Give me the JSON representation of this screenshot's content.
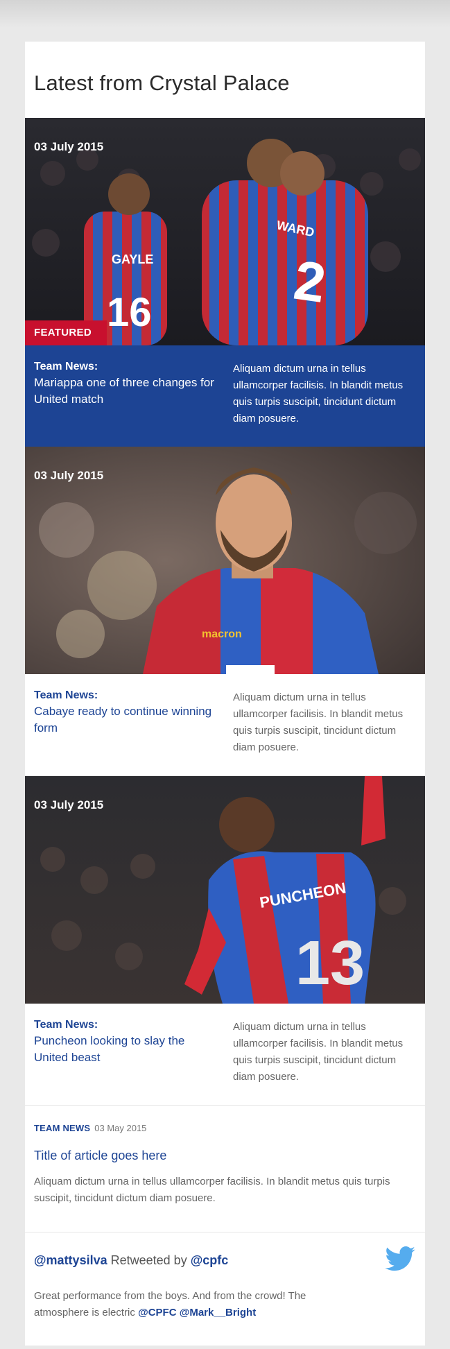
{
  "section_title": "Latest from Crystal Palace",
  "stories": [
    {
      "date": "03 July 2015",
      "badge": "FEATURED",
      "category": "Team News:",
      "title": "Mariappa one of three changes for United match",
      "description": "Aliquam dictum urna in tellus ullamcorper facilisis. In blandit metus quis turpis suscipit, tincidunt dictum diam posuere.",
      "image_names": [
        "GAYLE",
        "16",
        "WARD",
        "2"
      ]
    },
    {
      "date": "03 July 2015",
      "category": "Team News:",
      "title": "Cabaye ready to continue winning form",
      "description": "Aliquam dictum urna in tellus ullamcorper facilisis. In blandit metus quis turpis suscipit, tincidunt dictum diam posuere.",
      "image_sponsor": "macron"
    },
    {
      "date": "03 July 2015",
      "category": "Team News:",
      "title": "Puncheon looking to slay the United beast",
      "description": "Aliquam dictum urna in tellus ullamcorper facilisis. In blandit metus quis turpis suscipit, tincidunt dictum diam posuere.",
      "image_names": [
        "PUNCHEON",
        "13"
      ]
    }
  ],
  "news_item": {
    "tag": "TEAM NEWS",
    "date": "03 May 2015",
    "title": "Title of article goes here",
    "description": "Aliquam dictum urna in tellus ullamcorper facilisis. In blandit metus quis turpis suscipit, tincidunt dictum diam posuere."
  },
  "tweet": {
    "user": "@mattysilva",
    "retweeted_by_label": "Retweeted by",
    "retweeter": "@cpfc",
    "text": "Great performance from the boys. And from the crowd! The atmosphere is electric",
    "mentions": [
      "@CPFC",
      "@Mark__Bright"
    ],
    "icon": "twitter-bird-icon"
  },
  "colors": {
    "brand_blue": "#1d4494",
    "brand_red": "#c8102e",
    "twitter_blue": "#55acee",
    "page_bg": "#e9e9e9"
  }
}
